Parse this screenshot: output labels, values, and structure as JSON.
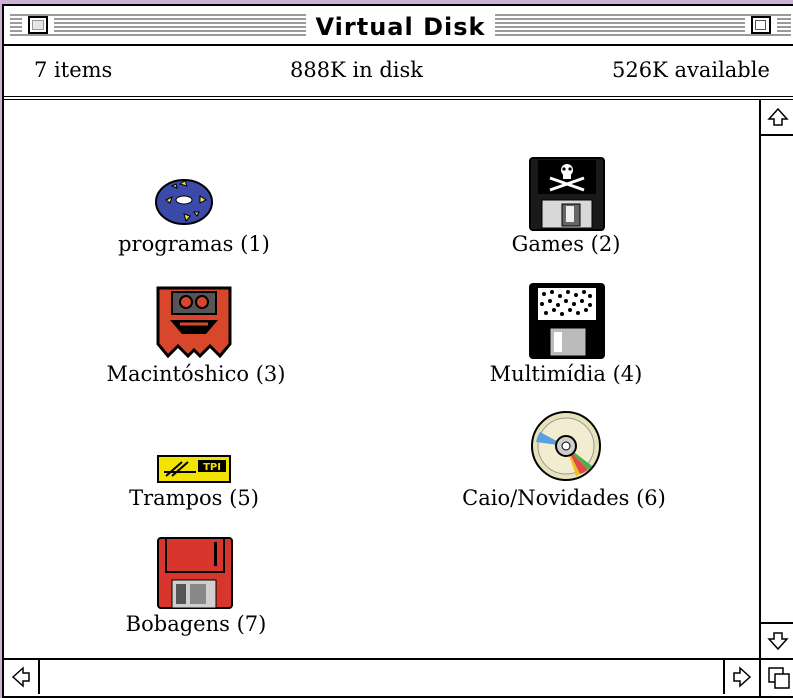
{
  "window": {
    "title": "Virtual Disk"
  },
  "info": {
    "items": "7 items",
    "disk_used": "888K in disk",
    "available": "526K available"
  },
  "icons": [
    {
      "label": "programas (1)",
      "icon": "disk-volume-icon"
    },
    {
      "label": "Games (2)",
      "icon": "skull-floppy-icon"
    },
    {
      "label": "Macintóshico (3)",
      "icon": "mac-folder-icon"
    },
    {
      "label": "Multimídia (4)",
      "icon": "multimedia-floppy-icon"
    },
    {
      "label": "Trampos (5)",
      "icon": "tpi-folder-icon"
    },
    {
      "label": "Caio/Novidades (6)",
      "icon": "cd-icon"
    },
    {
      "label": "Bobagens (7)",
      "icon": "red-floppy-icon"
    }
  ],
  "colors": {
    "desktop": "#cbb1d8",
    "disk_blue": "#3b4aa8",
    "mac_red": "#d8472c",
    "tpi_yellow": "#f3e400",
    "floppy_red": "#d8352c"
  }
}
